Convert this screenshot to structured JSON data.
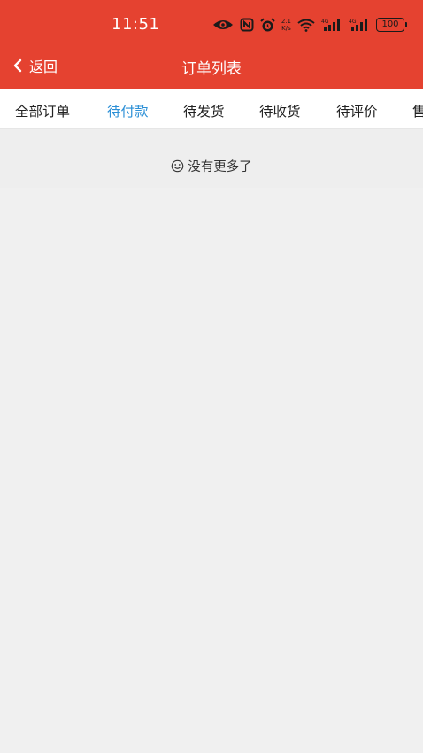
{
  "status_bar": {
    "time": "11:51",
    "net_speed_value": "2.1",
    "net_speed_unit": "K/s",
    "battery": "100",
    "icons": [
      "eye-icon",
      "nfc-icon",
      "alarm-icon",
      "wifi-icon",
      "signal-4g-icon",
      "signal-4g-icon",
      "battery-icon"
    ]
  },
  "nav": {
    "back_label": "返回",
    "title": "订单列表"
  },
  "tabs": [
    {
      "label": "全部订单",
      "active": false
    },
    {
      "label": "待付款",
      "active": true
    },
    {
      "label": "待发货",
      "active": false
    },
    {
      "label": "待收货",
      "active": false
    },
    {
      "label": "待评价",
      "active": false
    },
    {
      "label": "售",
      "active": false
    }
  ],
  "empty": {
    "icon": "smile-icon",
    "text": "没有更多了"
  },
  "colors": {
    "header": "#e54230",
    "active_tab": "#2b8fd6",
    "background": "#f0f0f0"
  }
}
